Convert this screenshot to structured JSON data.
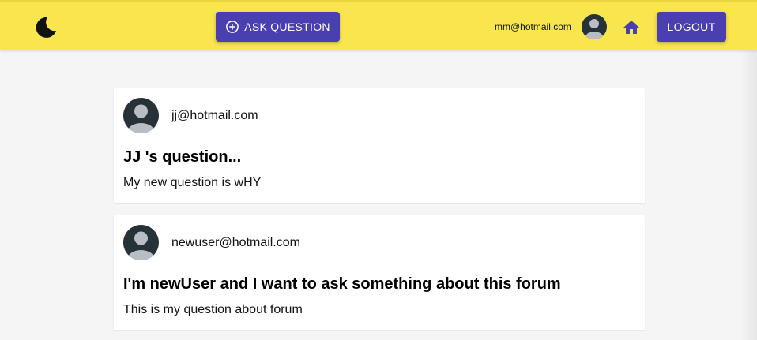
{
  "header": {
    "ask_label": "ASK QUESTION",
    "user_email": "mm@hotmail.com",
    "logout_label": "LOGOUT",
    "icons": {
      "logo": "moon-icon",
      "ask": "add-circle-icon",
      "avatar": "user-avatar-icon",
      "home": "home-icon"
    }
  },
  "colors": {
    "topbar": "#f9e64f",
    "accent": "#4a3fb0",
    "avatar_dark": "#263238",
    "avatar_light": "#b9bec4"
  },
  "questions": [
    {
      "author": "jj@hotmail.com",
      "title": "JJ 's question...",
      "body": "My new question is wHY"
    },
    {
      "author": "newuser@hotmail.com",
      "title": "I'm newUser and I want to ask something about this forum",
      "body": "This is my question about forum"
    }
  ]
}
